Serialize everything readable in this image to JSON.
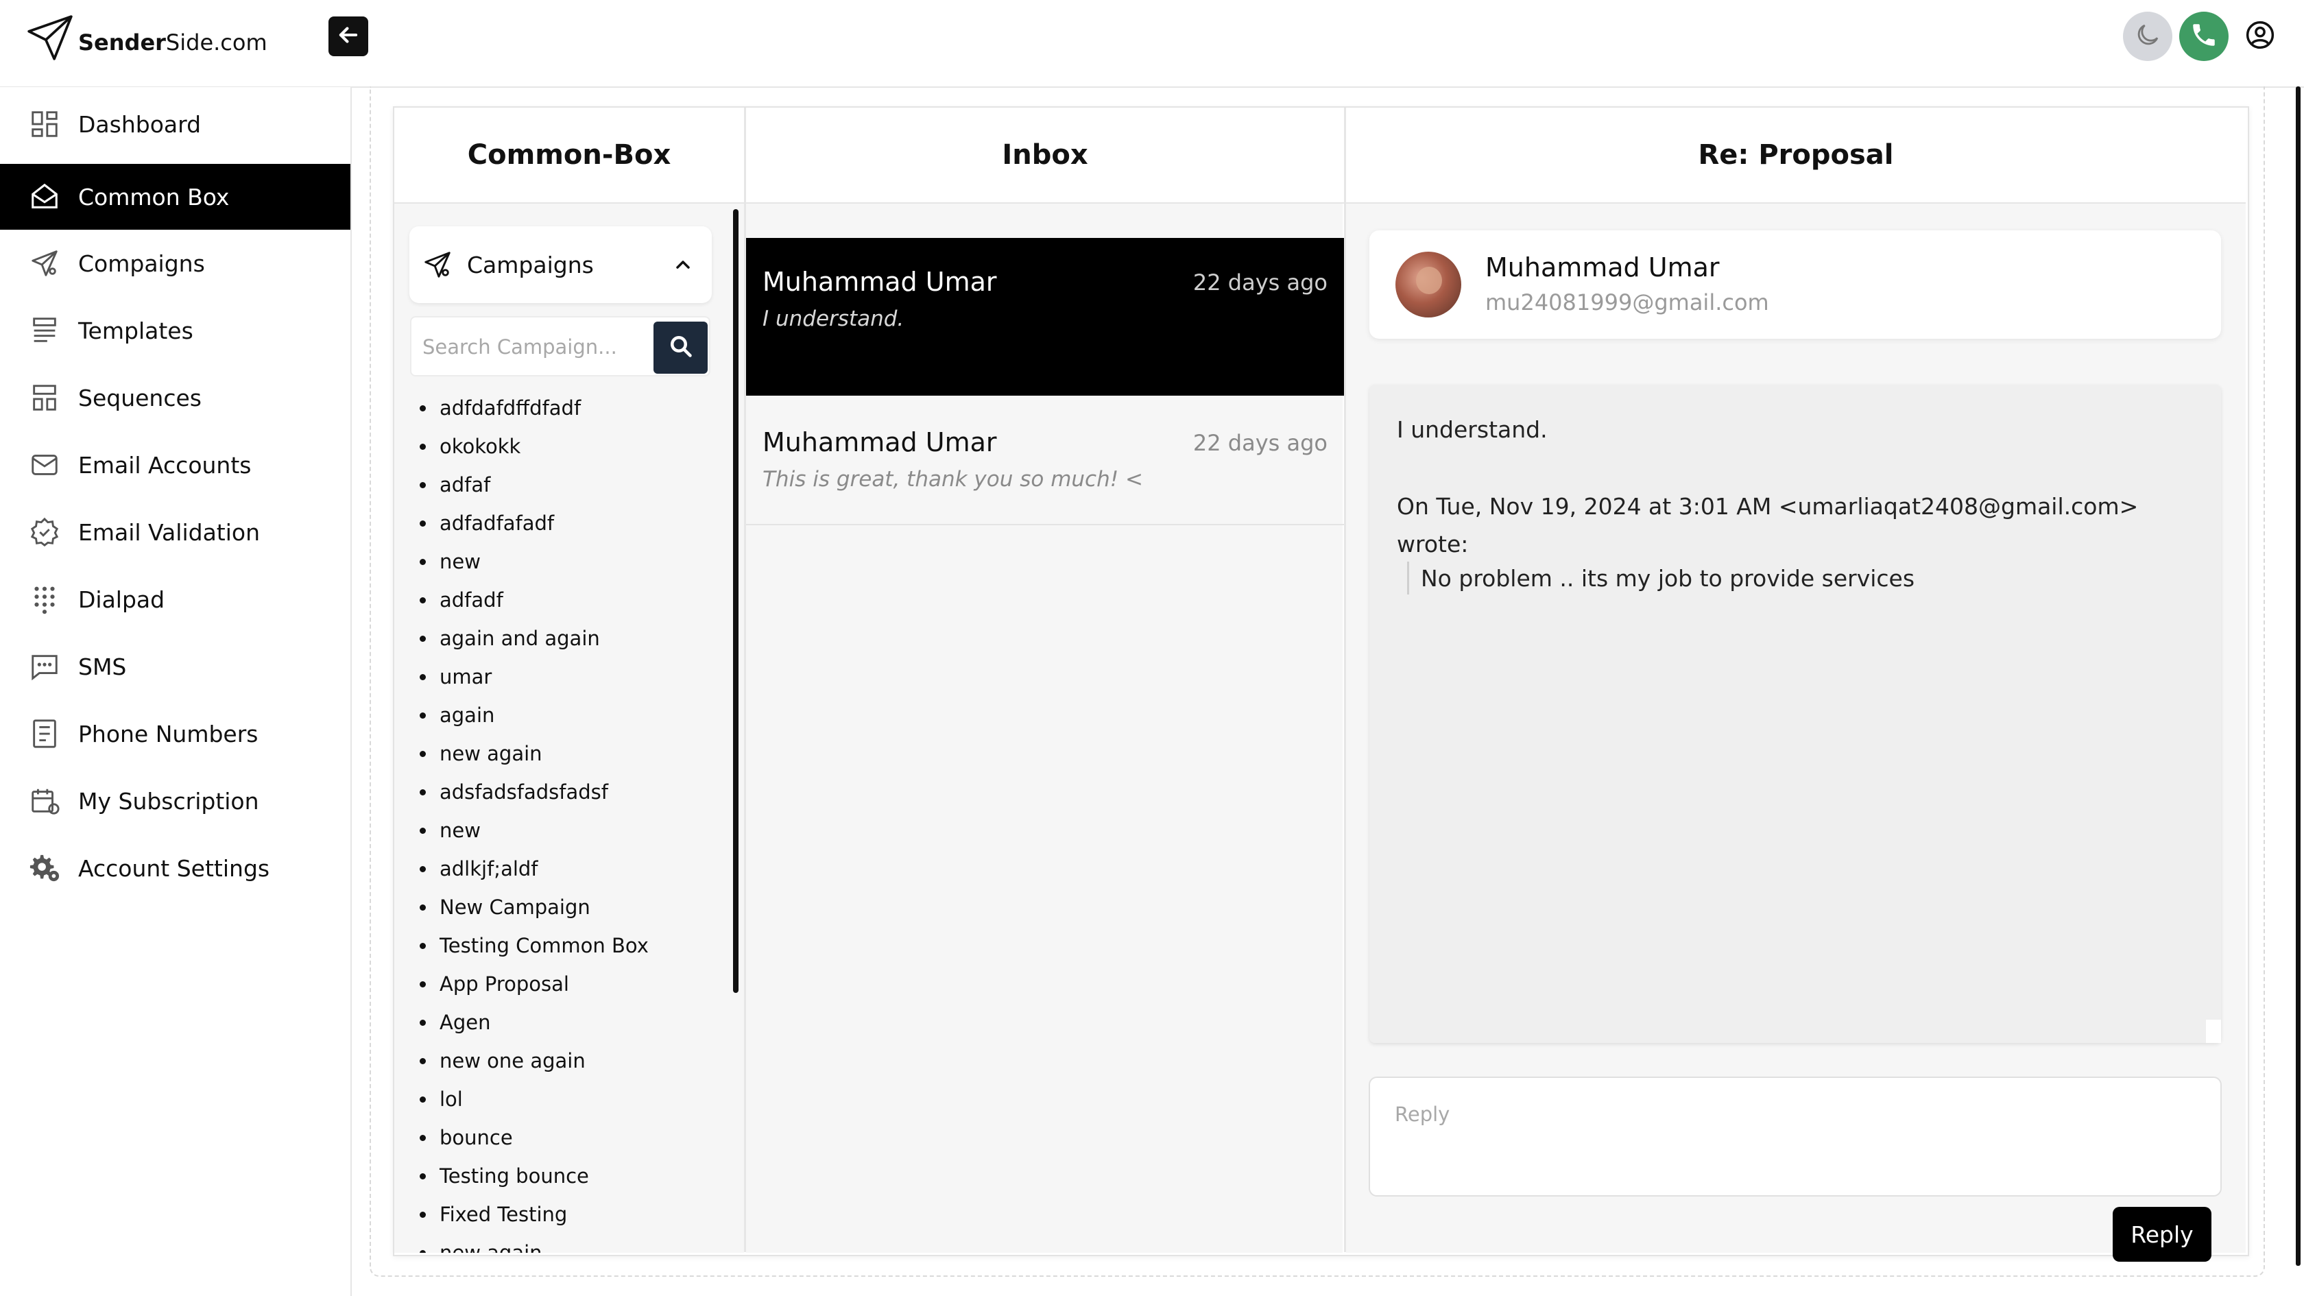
{
  "app": {
    "logo_text_bold": "Sender",
    "logo_text_rest": "Side.com"
  },
  "sidebar": {
    "items": [
      {
        "label": "Dashboard",
        "icon": "dashboard-icon",
        "active": false
      },
      {
        "label": "Common Box",
        "icon": "inbox-icon",
        "active": true
      },
      {
        "label": "Compaigns",
        "icon": "send-icon",
        "active": false
      },
      {
        "label": "Templates",
        "icon": "templates-icon",
        "active": false
      },
      {
        "label": "Sequences",
        "icon": "sequences-icon",
        "active": false
      },
      {
        "label": "Email Accounts",
        "icon": "mail-icon",
        "active": false
      },
      {
        "label": "Email Validation",
        "icon": "badge-check-icon",
        "active": false
      },
      {
        "label": "Dialpad",
        "icon": "dialpad-icon",
        "active": false
      },
      {
        "label": "SMS",
        "icon": "sms-icon",
        "active": false
      },
      {
        "label": "Phone Numbers",
        "icon": "phone-list-icon",
        "active": false
      },
      {
        "label": "My Subscription",
        "icon": "subscription-icon",
        "active": false
      },
      {
        "label": "Account Settings",
        "icon": "settings-icon",
        "active": false
      }
    ]
  },
  "columns": {
    "common_box": "Common-Box",
    "inbox": "Inbox",
    "detail": "Re: Proposal"
  },
  "campaigns": {
    "title": "Campaigns",
    "search_placeholder": "Search Campaign...",
    "items": [
      "adfdafdffdfadf",
      "okokokk",
      "adfaf",
      "adfadfafadf",
      "new",
      "adfadf",
      "again and again",
      "umar",
      "again",
      "new again",
      "adsfadsfadsfadsf",
      "new",
      "adlkjf;aldf",
      "New Campaign",
      "Testing Common Box",
      "App Proposal",
      "Agen",
      "new one again",
      "lol",
      "bounce",
      "Testing bounce",
      "Fixed Testing",
      "new again"
    ]
  },
  "inbox": {
    "messages": [
      {
        "sender": "Muhammad Umar",
        "time": "22 days ago",
        "snippet": "I understand.",
        "active": true
      },
      {
        "sender": "Muhammad Umar",
        "time": "22 days ago",
        "snippet": "This is great, thank you so much! <",
        "active": false
      }
    ]
  },
  "detail": {
    "sender_name": "Muhammad Umar",
    "sender_email": "mu24081999@gmail.com",
    "body_line1": "I understand.",
    "body_line2": "On Tue, Nov 19, 2024 at 3:01 AM <umarliaqat2408@gmail.com>",
    "body_line3": "wrote:",
    "quote": "No problem .. its my job to provide services",
    "reply_placeholder": "Reply",
    "reply_button": "Reply"
  }
}
